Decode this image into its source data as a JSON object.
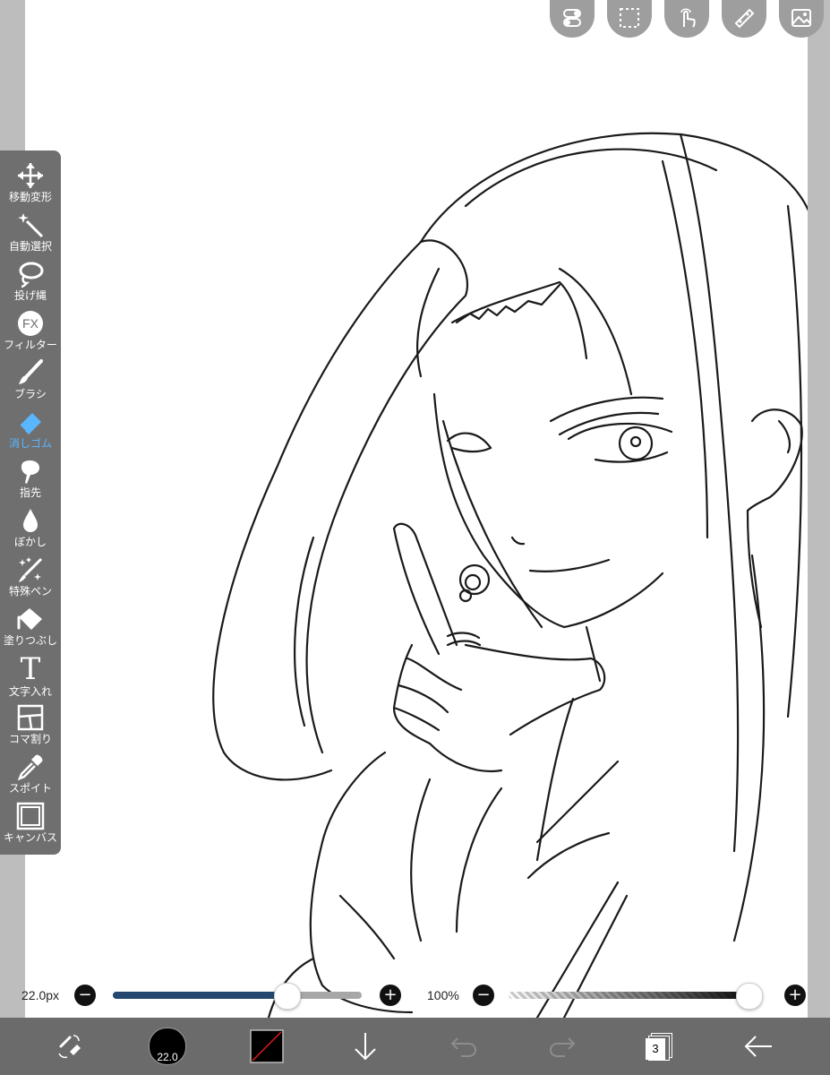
{
  "toolbar": {
    "tools": [
      {
        "label": "移動変形",
        "icon": "move-icon"
      },
      {
        "label": "自動選択",
        "icon": "magic-wand-icon"
      },
      {
        "label": "投げ縄",
        "icon": "lasso-icon"
      },
      {
        "label": "フィルター",
        "icon": "fx-icon",
        "glyph": "FX"
      },
      {
        "label": "ブラシ",
        "icon": "brush-icon"
      },
      {
        "label": "消しゴム",
        "icon": "eraser-icon",
        "active": true
      },
      {
        "label": "指先",
        "icon": "smudge-icon"
      },
      {
        "label": "ぼかし",
        "icon": "blur-icon"
      },
      {
        "label": "特殊ペン",
        "icon": "special-pen-icon"
      },
      {
        "label": "塗りつぶし",
        "icon": "fill-icon"
      },
      {
        "label": "文字入れ",
        "icon": "text-icon",
        "glyph": "T"
      },
      {
        "label": "コマ割り",
        "icon": "frame-divider-icon"
      },
      {
        "label": "スポイト",
        "icon": "eyedropper-icon"
      },
      {
        "label": "キャンバス",
        "icon": "canvas-icon"
      }
    ]
  },
  "brush_size": {
    "value_label": "22.0px",
    "minus": "−",
    "plus": "+",
    "fraction": 0.72
  },
  "opacity": {
    "value_label": "100%",
    "minus": "−",
    "plus": "+",
    "fraction": 1.0
  },
  "bottom_bar": {
    "brush_size_badge": "22.0",
    "layer_count": "3"
  },
  "colors": {
    "accent": "#5ab6ff",
    "slider_fill": "#23476e",
    "toolbar_bg": "#6f6f6f",
    "bottom_bar_bg": "#6b6b6b"
  }
}
